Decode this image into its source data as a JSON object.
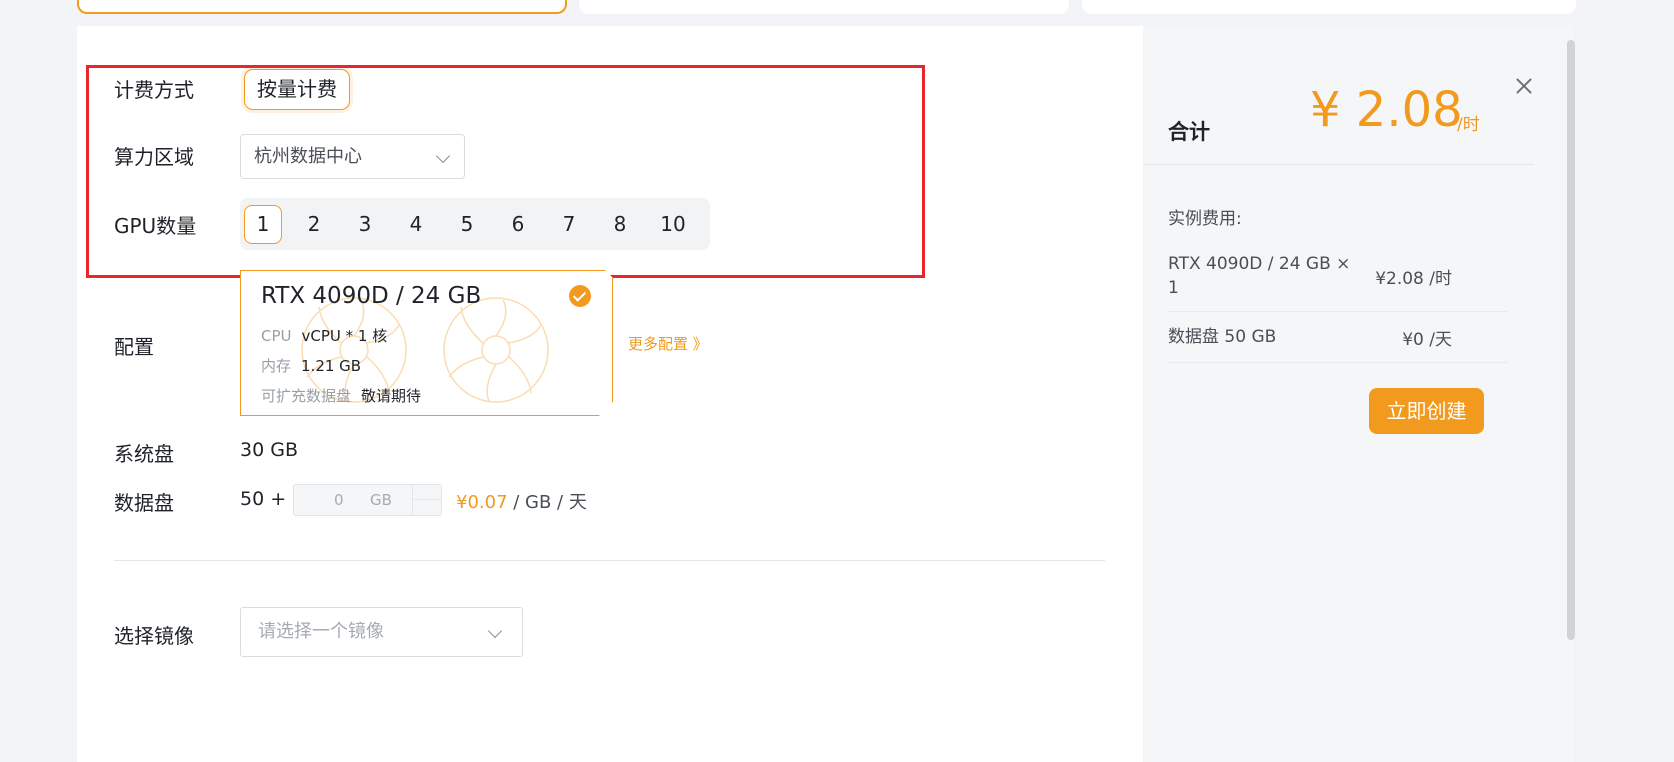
{
  "billing": {
    "label": "计费方式",
    "option": "按量计费"
  },
  "region": {
    "label": "算力区域",
    "value": "杭州数据中心"
  },
  "gpu_count": {
    "label": "GPU数量",
    "options": [
      "1",
      "2",
      "3",
      "4",
      "5",
      "6",
      "7",
      "8",
      "10"
    ],
    "selected": "1"
  },
  "config": {
    "label": "配置",
    "card": {
      "gpu_name": "RTX 4090D / 24 GB",
      "cpu_key": "CPU",
      "cpu_val": "vCPU * 1 核",
      "mem_key": "内存",
      "mem_val": "1.21 GB",
      "disk_key": "可扩充数据盘",
      "disk_val": "敬请期待"
    },
    "more": "更多配置 》"
  },
  "system_disk": {
    "label": "系统盘",
    "value": "30 GB"
  },
  "data_disk": {
    "label": "数据盘",
    "prefix": "50 +",
    "input_value": "0",
    "unit": "GB",
    "price": "¥0.07",
    "price_unit": " / GB / 天"
  },
  "image": {
    "label": "选择镜像",
    "placeholder": "请选择一个镜像"
  },
  "summary": {
    "total_label": "合计",
    "total_price": "¥ 2.08",
    "total_unit": "/时",
    "fee_title": "实例费用:",
    "items": [
      {
        "name": "RTX 4090D / 24 GB × 1",
        "price": "¥2.08 /时"
      },
      {
        "name": "数据盘 50 GB",
        "price": "¥0 /天"
      }
    ],
    "create_label": "立即创建"
  },
  "colors": {
    "accent": "#f29a1d",
    "highlight": "#e8262b"
  }
}
